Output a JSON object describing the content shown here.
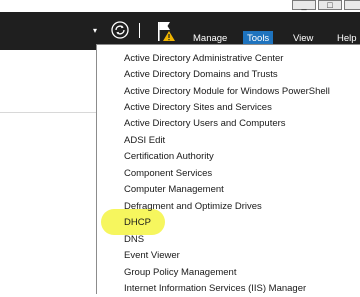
{
  "window": {
    "minimize_label": "_",
    "maximize_label": "□"
  },
  "toolbar": {
    "menu": [
      "Manage",
      "Tools",
      "View",
      "Help"
    ],
    "active": "Tools"
  },
  "tools_menu": {
    "items": [
      "Active Directory Administrative Center",
      "Active Directory Domains and Trusts",
      "Active Directory Module for Windows PowerShell",
      "Active Directory Sites and Services",
      "Active Directory Users and Computers",
      "ADSI Edit",
      "Certification Authority",
      "Component Services",
      "Computer Management",
      "Defragment and Optimize Drives",
      "DHCP",
      "DNS",
      "Event Viewer",
      "Group Policy Management",
      "Internet Information Services (IIS) Manager"
    ],
    "highlighted": "DHCP",
    "highlight_color": "#f5f542"
  },
  "colors": {
    "toolbar_bg": "#1f1f1f",
    "active_menu_bg": "#1e73be",
    "warning": "#f0b400"
  }
}
